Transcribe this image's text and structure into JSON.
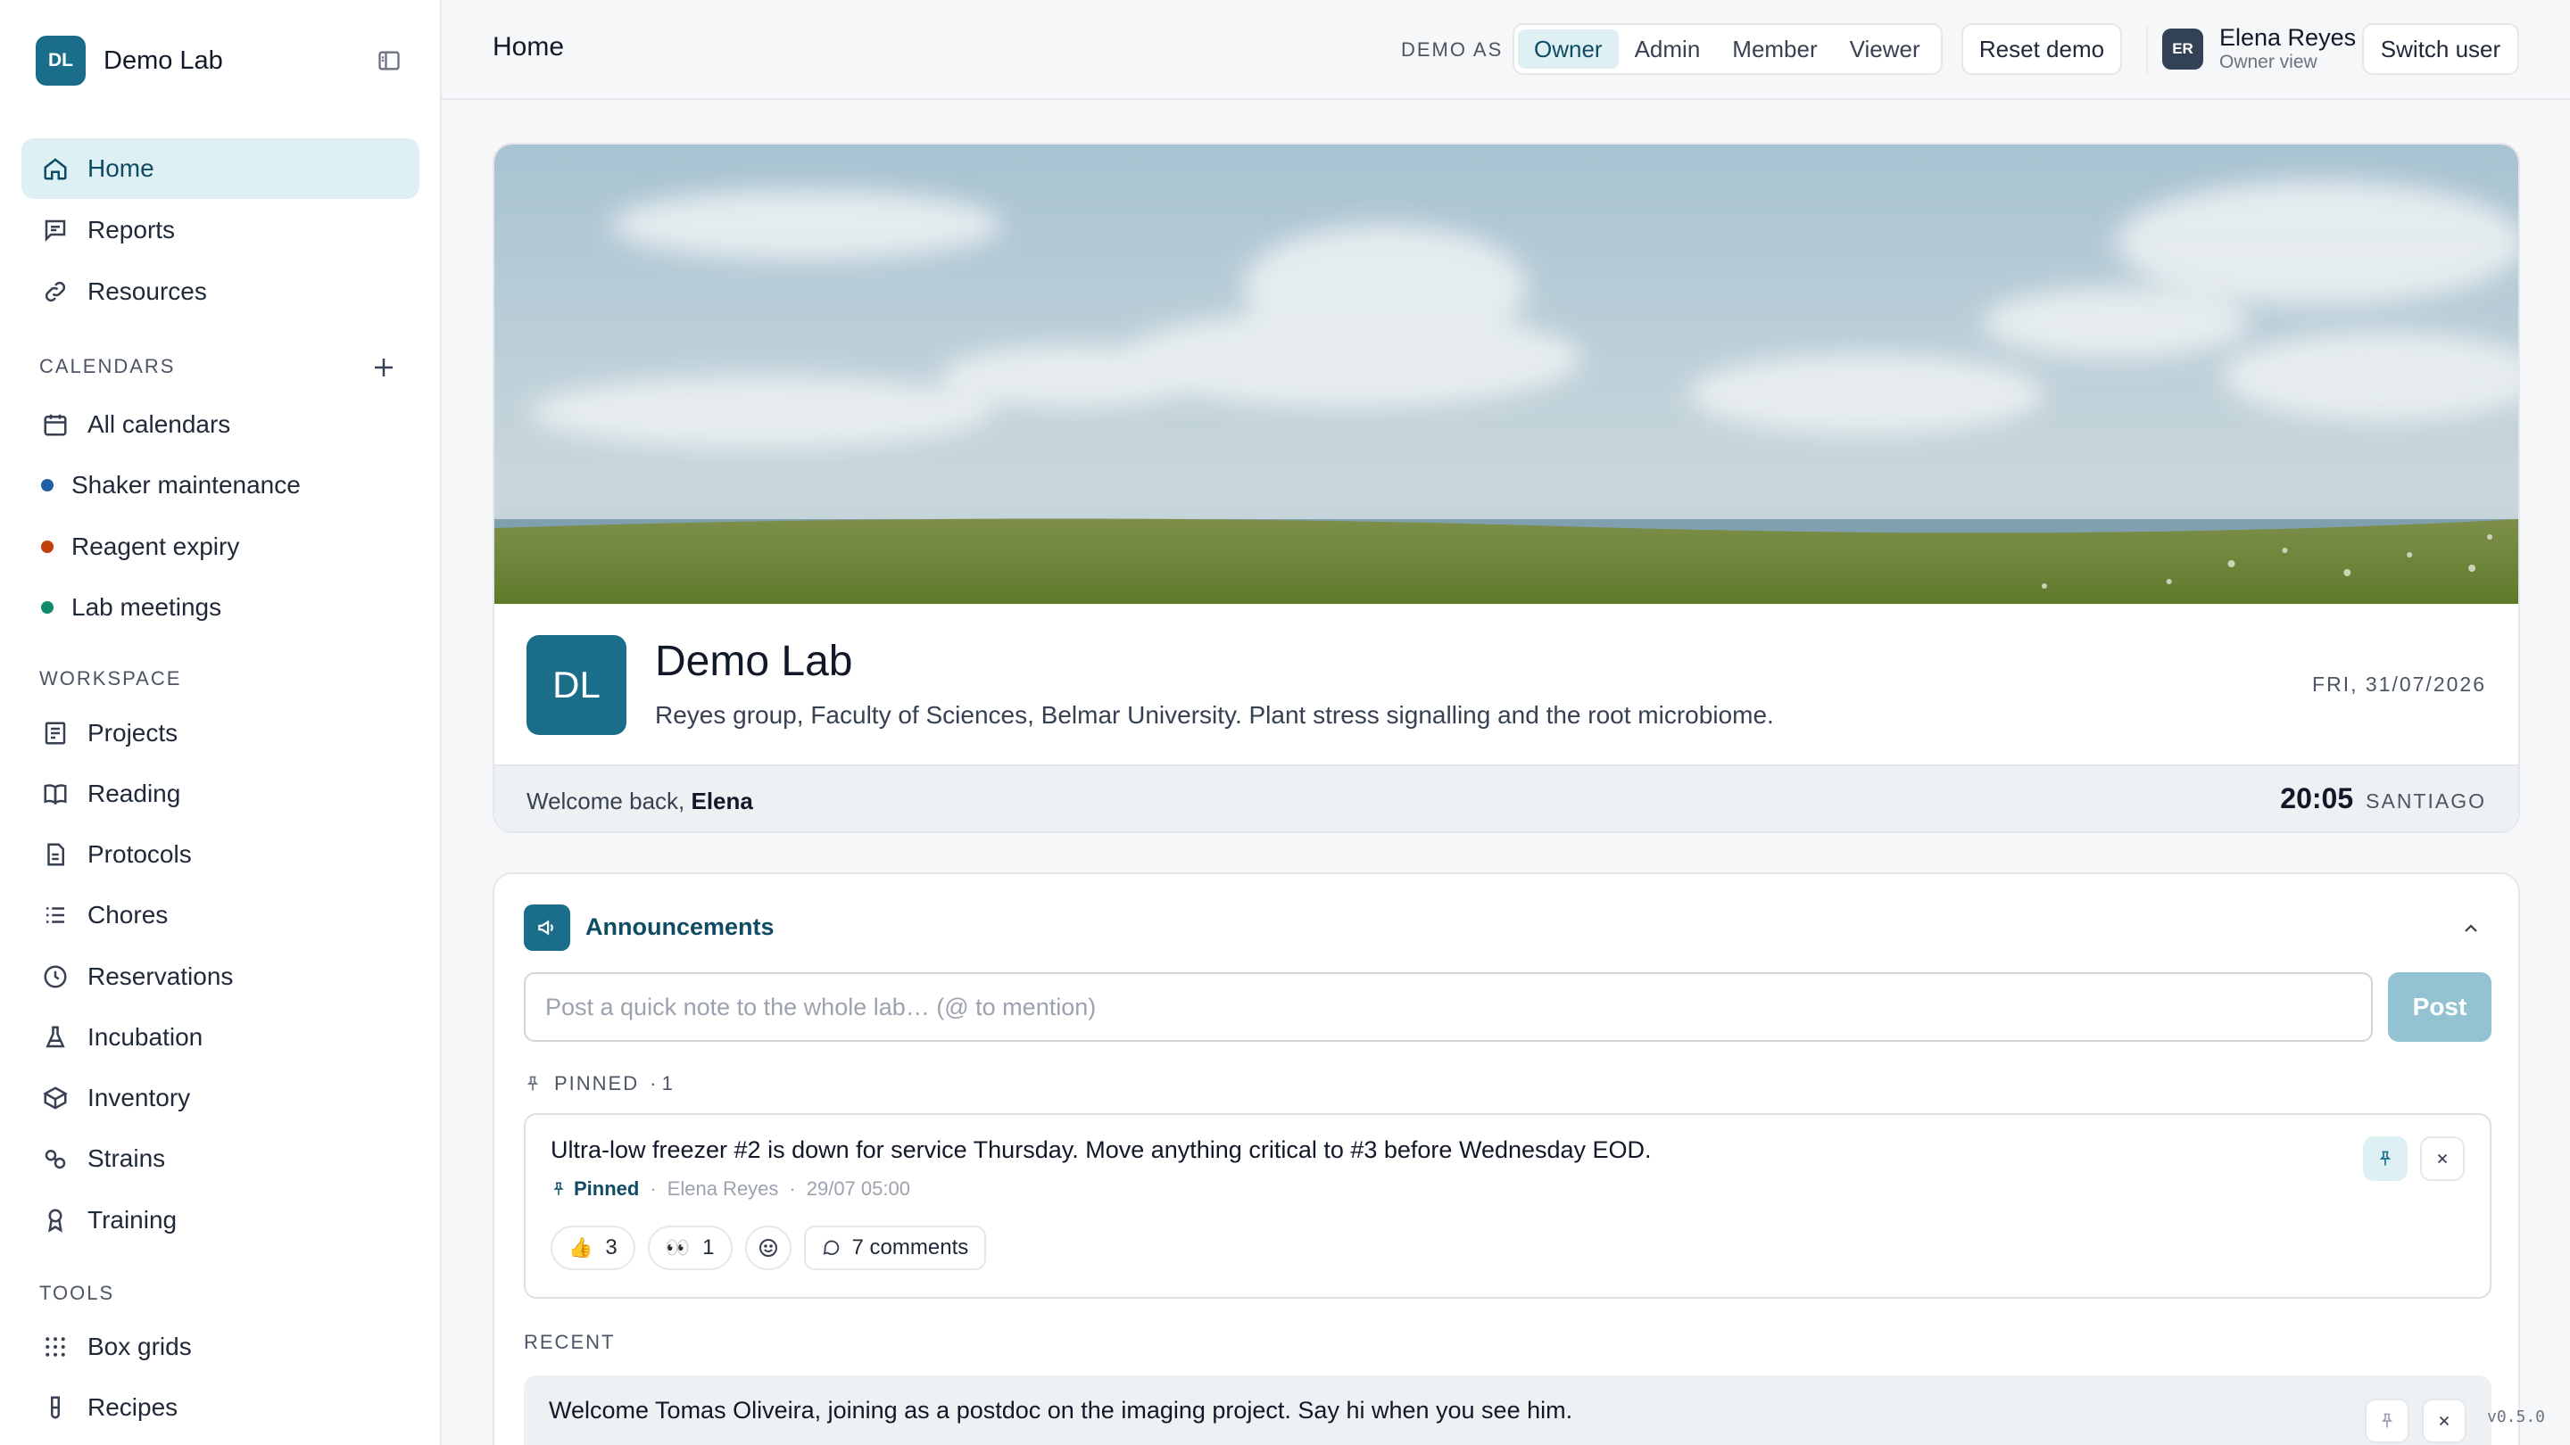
{
  "brand": {
    "badge": "DL",
    "name": "Demo Lab"
  },
  "nav": {
    "primary": [
      {
        "label": "Home",
        "icon": "home-icon",
        "active": true
      },
      {
        "label": "Reports",
        "icon": "chat-icon"
      },
      {
        "label": "Resources",
        "icon": "link-icon"
      }
    ],
    "calendars_label": "CALENDARS",
    "calendars": [
      {
        "label": "All calendars",
        "icon": "calendar-icon"
      },
      {
        "label": "Shaker maintenance",
        "color": "#1f5fa8"
      },
      {
        "label": "Reagent expiry",
        "color": "#c2410c"
      },
      {
        "label": "Lab meetings",
        "color": "#0f8a6a"
      }
    ],
    "workspace_label": "WORKSPACE",
    "workspace": [
      {
        "label": "Projects",
        "icon": "projects-icon"
      },
      {
        "label": "Reading",
        "icon": "book-icon"
      },
      {
        "label": "Protocols",
        "icon": "document-icon"
      },
      {
        "label": "Chores",
        "icon": "list-icon"
      },
      {
        "label": "Reservations",
        "icon": "clock-icon"
      },
      {
        "label": "Incubation",
        "icon": "flask-icon"
      },
      {
        "label": "Inventory",
        "icon": "box-icon"
      },
      {
        "label": "Strains",
        "icon": "strains-icon"
      },
      {
        "label": "Training",
        "icon": "award-icon"
      }
    ],
    "tools_label": "TOOLS",
    "tools": [
      {
        "label": "Box grids",
        "icon": "grid-icon"
      },
      {
        "label": "Recipes",
        "icon": "tube-icon"
      }
    ]
  },
  "topbar": {
    "title": "Home",
    "demo_as": "DEMO AS",
    "roles": [
      "Owner",
      "Admin",
      "Member",
      "Viewer"
    ],
    "active_role": "Owner",
    "reset": "Reset demo",
    "user": {
      "initials": "ER",
      "name": "Elena Reyes",
      "sub": "Owner view"
    },
    "switch": "Switch user"
  },
  "hero": {
    "badge": "DL",
    "title": "Demo Lab",
    "subtitle": "Reyes group, Faculty of Sciences, Belmar University. Plant stress signalling and the root microbiome.",
    "date": "FRI, 31/07/2026",
    "welcome_prefix": "Welcome back, ",
    "welcome_name": "Elena",
    "time": "20:05",
    "zone": "SANTIAGO"
  },
  "announcements": {
    "title": "Announcements",
    "input_placeholder": "Post a quick note to the whole lab… (@ to mention)",
    "post": "Post",
    "pinned_label": "PINNED",
    "pinned_count": "· 1",
    "pinned": {
      "text": "Ultra-low freezer #2 is down for service Thursday. Move anything critical to #3 before Wednesday EOD.",
      "tag": "Pinned",
      "author": "Elena Reyes",
      "time": "29/07 05:00",
      "reactions": [
        {
          "emoji": "👍",
          "count": "3"
        },
        {
          "emoji": "👀",
          "count": "1"
        }
      ],
      "comments": "7 comments"
    },
    "recent_label": "RECENT",
    "recent": {
      "text": "Welcome Tomas Oliveira, joining as a postdoc on the imaging project. Say hi when you see him."
    }
  },
  "version": "v0.5.0",
  "colors": {
    "accent": "#1a6e8a",
    "accent_soft": "#dff0f5",
    "post_disabled": "#93c3d2"
  }
}
